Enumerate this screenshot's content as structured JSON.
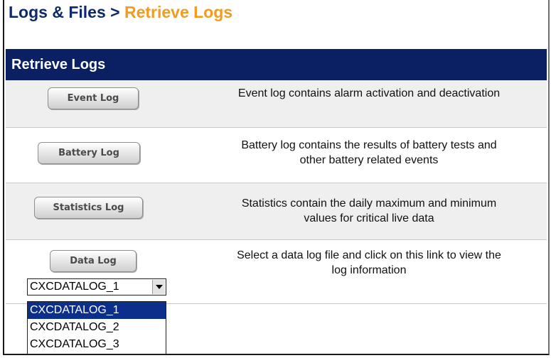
{
  "breadcrumb": {
    "root": "Logs & Files",
    "separator": ">",
    "current": "Retrieve Logs"
  },
  "section": {
    "title": "Retrieve Logs"
  },
  "logs": [
    {
      "button_label": "Event Log",
      "description": "Event log contains alarm activation and deactivation"
    },
    {
      "button_label": "Battery Log",
      "description_lines": [
        "Battery log contains the results of battery tests and",
        "other battery related events"
      ]
    },
    {
      "button_label": "Statistics Log",
      "description_lines": [
        "Statistics contain the daily maximum and minimum",
        "values for critical live data"
      ]
    },
    {
      "button_label": "Data Log",
      "description_lines": [
        "Select a data log file and click on this link to view the",
        "log information"
      ]
    }
  ],
  "datalog_select": {
    "value": "CXCDATALOG_1",
    "options": [
      "CXCDATALOG_1",
      "CXCDATALOG_2",
      "CXCDATALOG_3"
    ],
    "highlighted_index": 0
  },
  "colors": {
    "breadcrumb_root": "#0e2a6b",
    "breadcrumb_current": "#f39a1f",
    "section_bar": "#0b1f63",
    "alt_row": "#efefef",
    "selected_option": "#0d2f8c"
  },
  "icons": {
    "select_arrow": "triangle-down-icon"
  }
}
